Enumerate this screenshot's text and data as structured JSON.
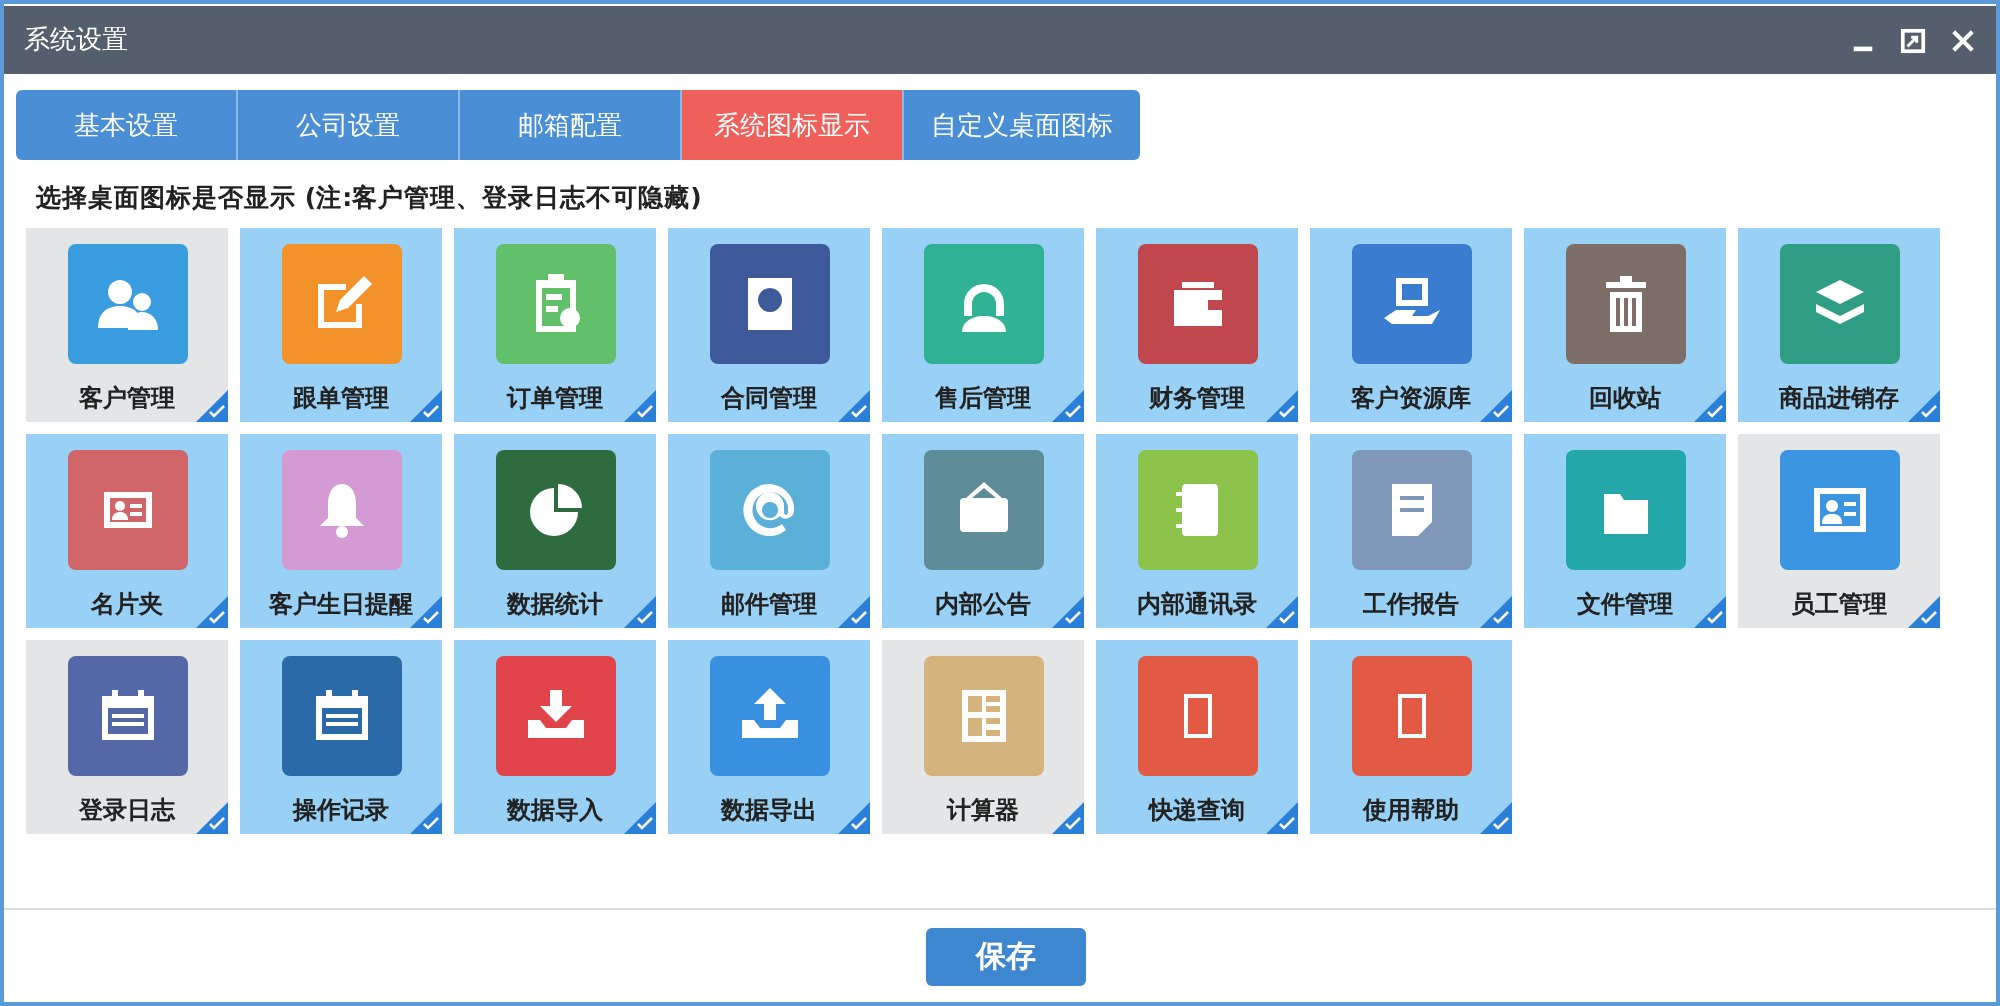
{
  "window": {
    "title": "系统设置"
  },
  "tabs": [
    {
      "label": "基本设置",
      "selected": false
    },
    {
      "label": "公司设置",
      "selected": false
    },
    {
      "label": "邮箱配置",
      "selected": false
    },
    {
      "label": "系统图标显示",
      "selected": true
    },
    {
      "label": "自定义桌面图标",
      "selected": false
    }
  ],
  "instruction": "选择桌面图标是否显示 (注:客户管理、登录日志不可隐藏)",
  "tiles": [
    {
      "label": "客户管理",
      "kind": "people",
      "color": "#3a9de0",
      "greyed": true,
      "checked": true
    },
    {
      "label": "跟单管理",
      "kind": "edit",
      "color": "#f4922a",
      "greyed": false,
      "checked": true
    },
    {
      "label": "订单管理",
      "kind": "clipboard",
      "color": "#62c06a",
      "greyed": false,
      "checked": true
    },
    {
      "label": "合同管理",
      "kind": "disc",
      "color": "#3f5a9a",
      "greyed": false,
      "checked": true
    },
    {
      "label": "售后管理",
      "kind": "support",
      "color": "#2fb394",
      "greyed": false,
      "checked": true
    },
    {
      "label": "财务管理",
      "kind": "wallet",
      "color": "#c0474e",
      "greyed": false,
      "checked": true
    },
    {
      "label": "客户资源库",
      "kind": "handbox",
      "color": "#3a7dd0",
      "greyed": false,
      "checked": true
    },
    {
      "label": "回收站",
      "kind": "trash",
      "color": "#7d6e68",
      "greyed": false,
      "checked": true
    },
    {
      "label": "商品进销存",
      "kind": "layers",
      "color": "#2f9e84",
      "greyed": false,
      "checked": true
    },
    {
      "label": "名片夹",
      "kind": "card",
      "color": "#d0656a",
      "greyed": false,
      "checked": true
    },
    {
      "label": "客户生日提醒",
      "kind": "bell",
      "color": "#d49ad4",
      "greyed": false,
      "checked": true
    },
    {
      "label": "数据统计",
      "kind": "pie",
      "color": "#2e6b3e",
      "greyed": false,
      "checked": true
    },
    {
      "label": "邮件管理",
      "kind": "at",
      "color": "#5ab0d8",
      "greyed": false,
      "checked": true
    },
    {
      "label": "内部公告",
      "kind": "sign",
      "color": "#5e8c99",
      "greyed": false,
      "checked": true
    },
    {
      "label": "内部通讯录",
      "kind": "contacts",
      "color": "#8cc34a",
      "greyed": false,
      "checked": true
    },
    {
      "label": "工作报告",
      "kind": "document",
      "color": "#7f97b8",
      "greyed": false,
      "checked": true
    },
    {
      "label": "文件管理",
      "kind": "folder",
      "color": "#23a7a8",
      "greyed": false,
      "checked": true
    },
    {
      "label": "员工管理",
      "kind": "idcard",
      "color": "#3b95e0",
      "greyed": true,
      "checked": true
    },
    {
      "label": "登录日志",
      "kind": "calendar",
      "color": "#5468a8",
      "greyed": true,
      "checked": true
    },
    {
      "label": "操作记录",
      "kind": "calendar",
      "color": "#2a6aa8",
      "greyed": false,
      "checked": true
    },
    {
      "label": "数据导入",
      "kind": "download",
      "color": "#e0444a",
      "greyed": false,
      "checked": true
    },
    {
      "label": "数据导出",
      "kind": "upload",
      "color": "#3a90e0",
      "greyed": false,
      "checked": true
    },
    {
      "label": "计算器",
      "kind": "calculator",
      "color": "#d4b47c",
      "greyed": true,
      "checked": true
    },
    {
      "label": "快递查询",
      "kind": "blank",
      "color": "#e25a44",
      "greyed": false,
      "checked": true
    },
    {
      "label": "使用帮助",
      "kind": "blank",
      "color": "#e25a44",
      "greyed": false,
      "checked": true
    }
  ],
  "save_button": "保存"
}
